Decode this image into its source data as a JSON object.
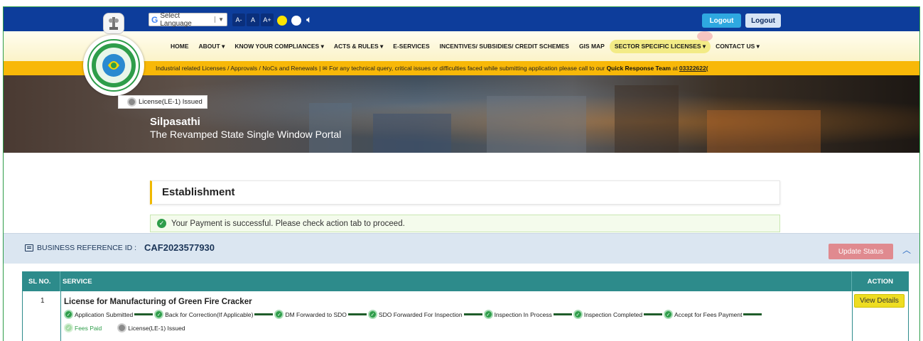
{
  "colors": {
    "topbar": "#0d3d9b",
    "marquee": "#f8b808",
    "success": "#2e9d4a",
    "table_header": "#2d8b8b",
    "update_button": "#e08a8f",
    "view_button": "#eedd22"
  },
  "topbar": {
    "language_label": "Select Language",
    "font_decrease": "A-",
    "font_normal": "A",
    "font_increase": "A+",
    "logout_primary": "Logout",
    "logout_secondary": "Logout"
  },
  "nav": {
    "items": [
      "HOME",
      "ABOUT ▾",
      "KNOW YOUR COMPLIANCES ▾",
      "ACTS & RULES ▾",
      "E-SERVICES",
      "INCENTIVES/ SUBSIDIES/ CREDIT SCHEMES",
      "GIS MAP",
      "SECTOR SPECIFIC LICENSES ▾",
      "CONTACT US ▾"
    ]
  },
  "marquee": {
    "text_pre": "Industrial related Licenses / Approvals / NoCs and Renewals | ",
    "text_mid": " For any technical query, critical issues or difficulties faced while submitting application please call to our ",
    "team": "Quick Response Team",
    "text_at": " at ",
    "phone": "03322622("
  },
  "hero": {
    "title": "Silpasathi",
    "subtitle": "The Revamped State Single Window Portal",
    "tooltip": "License(LE-1) Issued"
  },
  "main": {
    "section_title": "Establishment",
    "alert": "Your Payment is successful. Please check action tab to proceed.",
    "business_ref_label": "BUSINESS REFERENCE ID :",
    "business_ref_id": "CAF2023577930",
    "update_status": "Update Status"
  },
  "table": {
    "headers": {
      "sl": "SL NO.",
      "service": "SERVICE",
      "action": "ACTION"
    },
    "row": {
      "sl": "1",
      "service": "License for Manufacturing of Green Fire Cracker",
      "action": "View Details",
      "steps": [
        "Application Submitted",
        "Back for Correction(If Applicable)",
        "DM Forwarded to SDO",
        "SDO Forwarded For Inspection",
        "Inspection In Process",
        "Inspection Completed",
        "Accept for Fees Payment"
      ],
      "fees_paid": "Fees Paid",
      "issued": "License(LE-1) Issued"
    }
  }
}
